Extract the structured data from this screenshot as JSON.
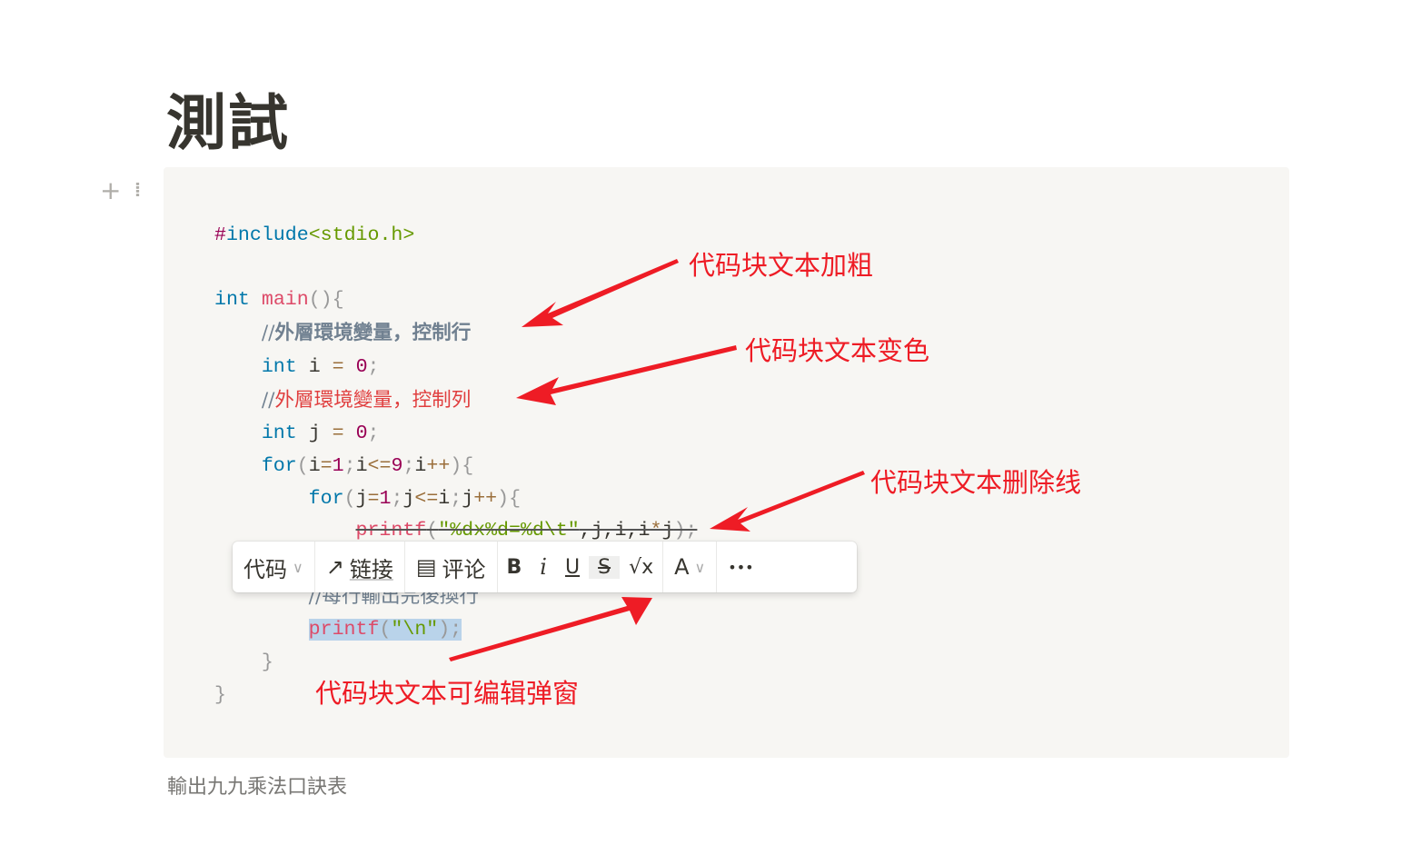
{
  "page": {
    "title": "測試",
    "caption": "輸出九九乘法口訣表"
  },
  "code": {
    "l1a": "#",
    "l1b": "include",
    "l1c": "<stdio.h>",
    "l3a": "int",
    "l3b": "main",
    "l3c": "(){",
    "l4a": "//",
    "l4b": "外層環境變量，控制行",
    "l5a": "int",
    "l5b": " i ",
    "l5c": "=",
    "l5d": "0",
    "l5e": ";",
    "l6a": "//",
    "l6b": "外層環境變量，控制列",
    "l7a": "int",
    "l7b": " j ",
    "l7c": "=",
    "l7d": "0",
    "l7e": ";",
    "l8": [
      "for",
      "(",
      "i",
      "=",
      "1",
      ";",
      "i",
      "<=",
      "9",
      ";",
      "i",
      "++",
      "){"
    ],
    "l9": [
      "for",
      "(",
      "j",
      "=",
      "1",
      ";",
      "j",
      "<=",
      "i",
      ";",
      "j",
      "++",
      "){"
    ],
    "l10a": "printf",
    "l10b": "(",
    "l10c": "\"%dx%d=%d\\t\"",
    "l10d": ",j,i,i",
    "l10e": "*",
    "l10f": "j",
    "l10g": ");",
    "l12": "//每行輸出完後換行",
    "l13a": "printf",
    "l13b": "(",
    "l13c": "\"\\n\"",
    "l13d": ");",
    "l14": "}",
    "l15": "}"
  },
  "toolbar": {
    "block_type": "代码",
    "link": "链接",
    "comment": "评论",
    "bold": "B",
    "italic": "i",
    "underline": "U",
    "strikethrough": "S",
    "equation": "√x",
    "color": "A",
    "more": "•••",
    "active": "strikethrough"
  },
  "annotations": {
    "bold": "代码块文本加粗",
    "color": "代码块文本变色",
    "strike": "代码块文本删除线",
    "popup": "代码块文本可编辑弹窗",
    "color_hex": "#ee1c25"
  }
}
